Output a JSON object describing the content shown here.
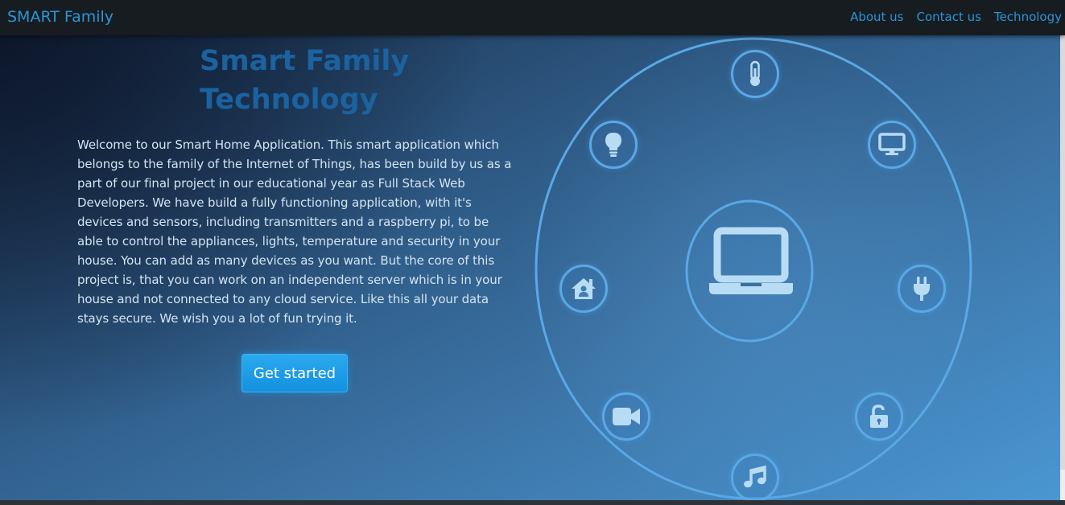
{
  "navbar": {
    "brand": "SMART Family",
    "links": [
      "About us",
      "Contact us",
      "Technology"
    ]
  },
  "hero": {
    "title_line1": "Smart Family",
    "title_line2": "Technology",
    "description": "Welcome to our Smart Home Application. This smart application which belongs to the family of the Internet of Things, has been build by us as a part of our final project in our educational year as Full Stack Web Developers. We have build a fully functioning application, with it's devices and sensors, including transmitters and a raspberry pi, to be able to control the appliances, lights, temperature and security in your house. You can add as many devices as you want. But the core of this project is, that you can work on an independent server which is in your house and not connected to any cloud service. Like this all your data stays secure. We wish you a lot of fun trying it.",
    "cta_label": "Get started"
  },
  "diagram": {
    "center_icon": "laptop-icon",
    "features": [
      "thermometer-icon",
      "monitor-icon",
      "plug-icon",
      "unlock-icon",
      "music-icon",
      "video-camera-icon",
      "home-user-icon",
      "lightbulb-icon"
    ]
  },
  "colors": {
    "brand": "#2a95d6",
    "title": "#1b62a0",
    "button": "#1e9de8",
    "ring": "#5aa8e6",
    "icon": "#b9dcf5"
  }
}
